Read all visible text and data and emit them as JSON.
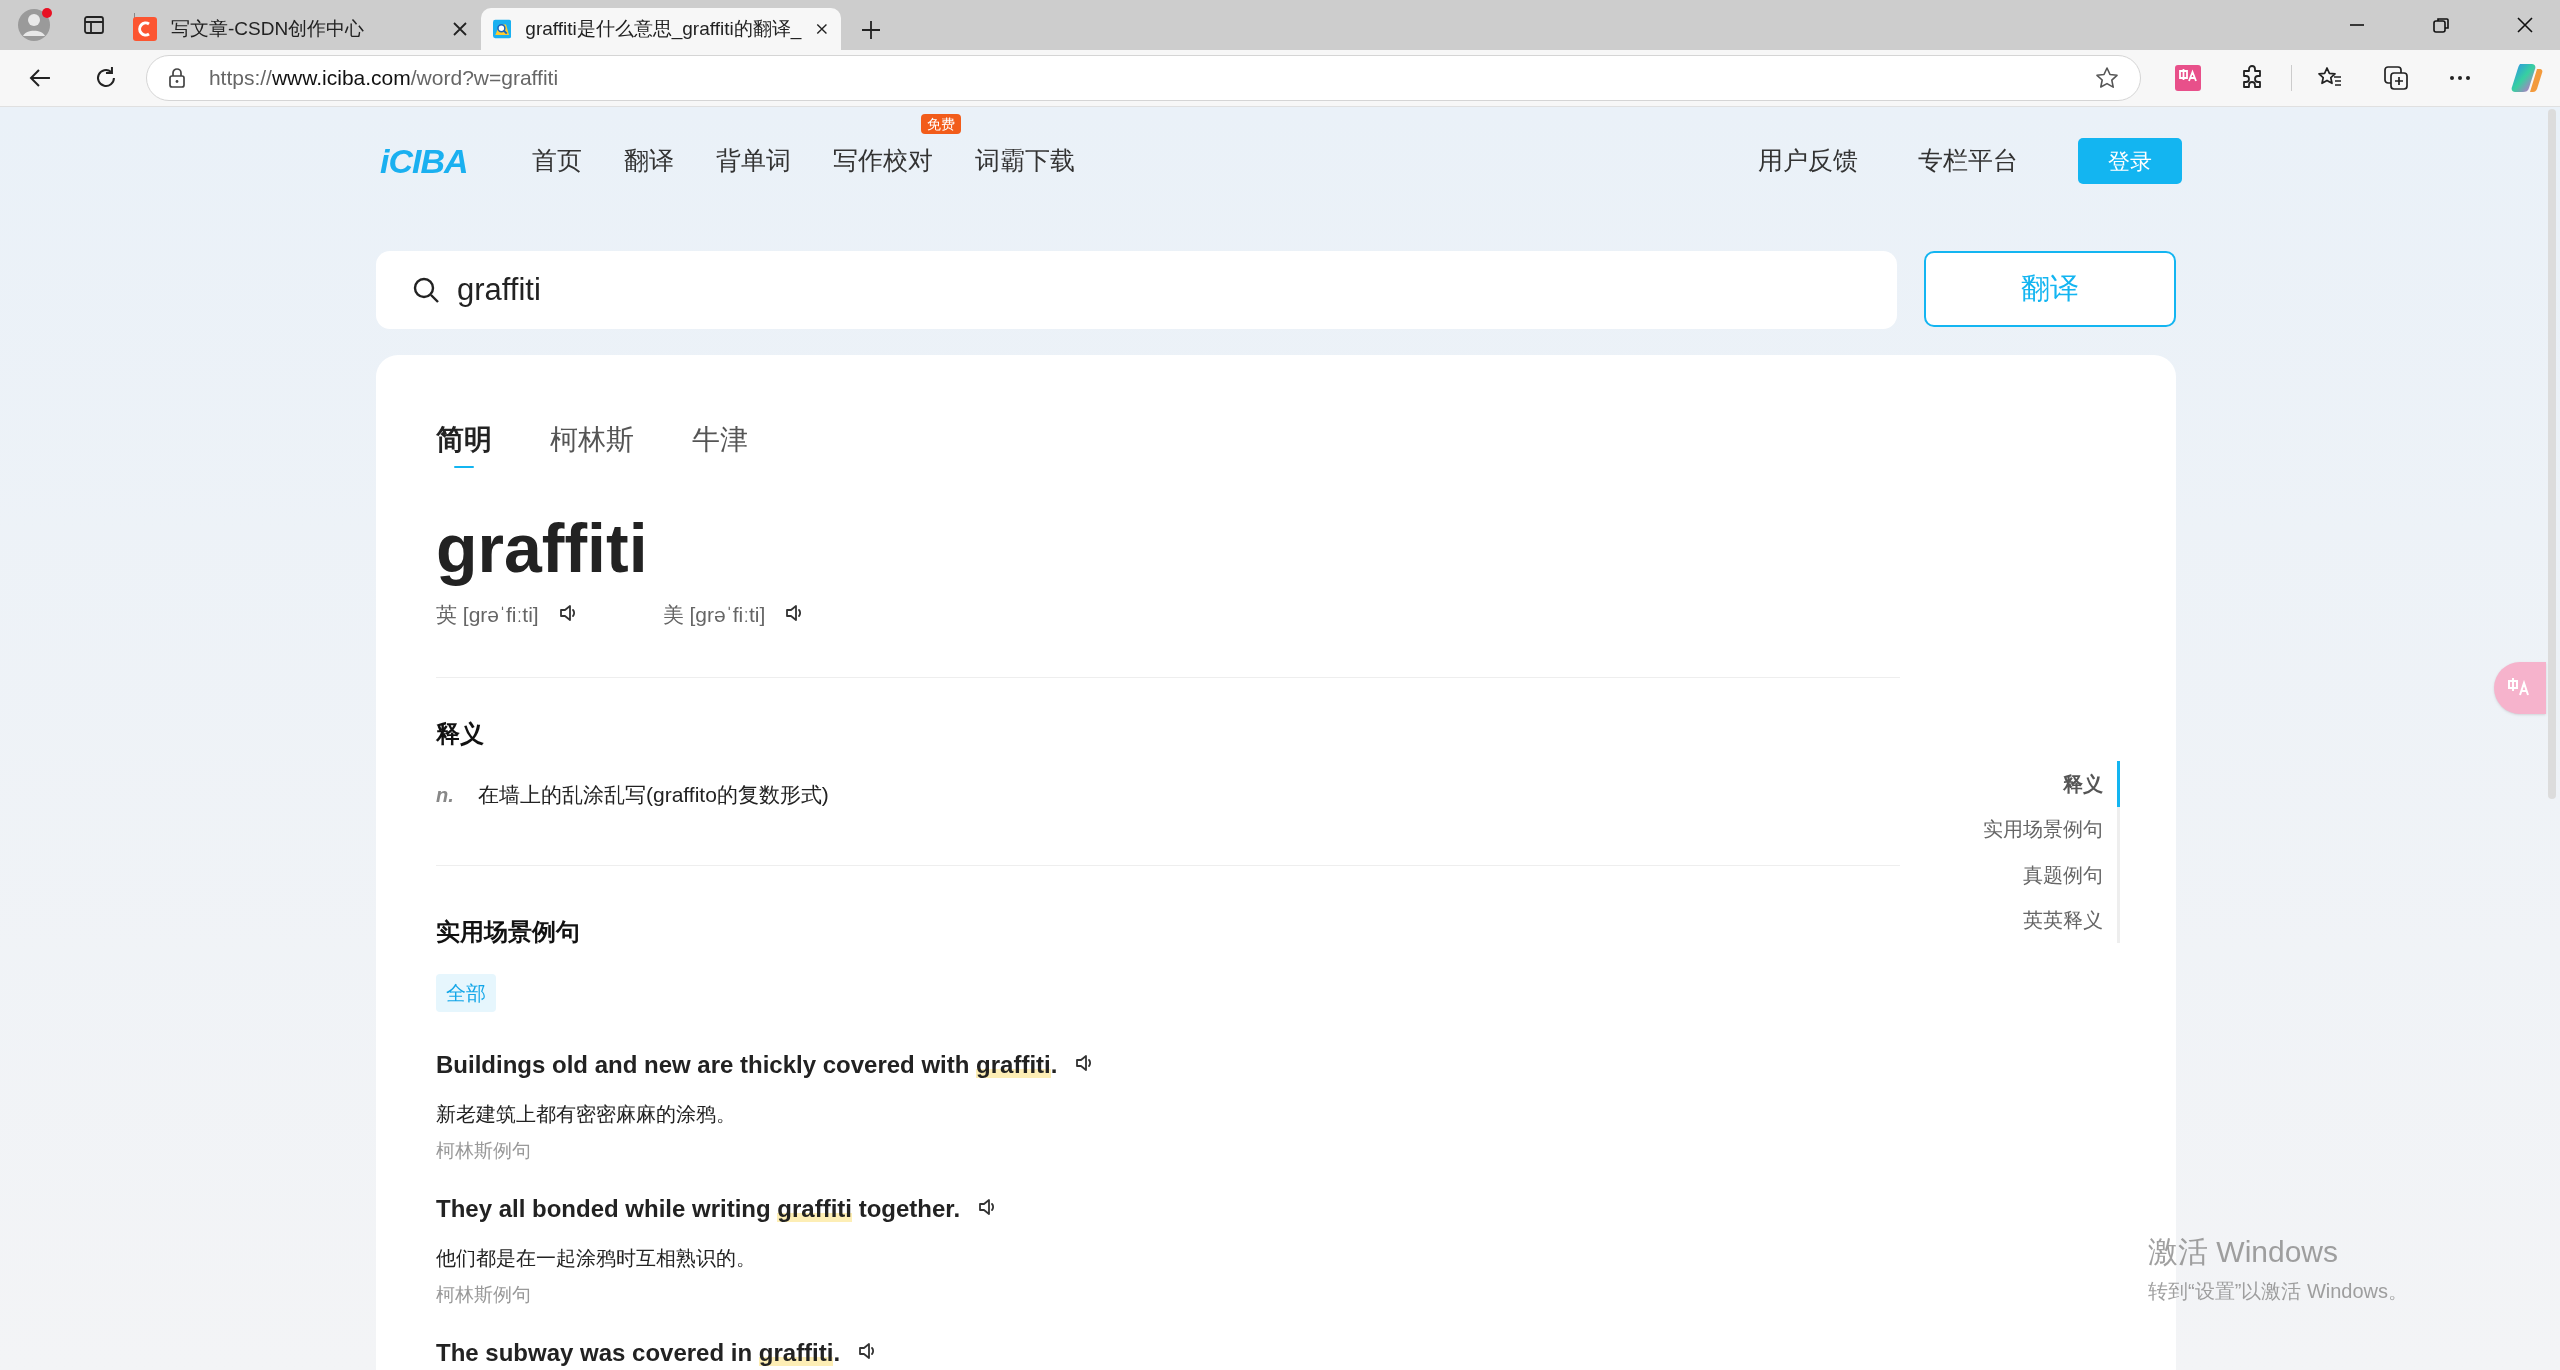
{
  "browser": {
    "tabs": [
      {
        "title": "写文章-CSDN创作中心",
        "kind": "csdn",
        "selected": false
      },
      {
        "title": "graffiti是什么意思_graffiti的翻译_",
        "kind": "iciba",
        "selected": true
      }
    ],
    "address": {
      "scheme": "https://",
      "host": "www.iciba.com",
      "path": "/word?w=graffiti"
    }
  },
  "site": {
    "logo": "iCIBA",
    "nav": [
      {
        "label": "首页"
      },
      {
        "label": "翻译"
      },
      {
        "label": "背单词"
      },
      {
        "label": "写作校对",
        "badge": "免费"
      },
      {
        "label": "词霸下载"
      }
    ],
    "nav_right": [
      "用户反馈",
      "专栏平台"
    ],
    "login": "登录"
  },
  "search": {
    "value": "graffiti",
    "button": "翻译"
  },
  "dict_tabs": [
    {
      "label": "简明",
      "selected": true
    },
    {
      "label": "柯林斯",
      "selected": false
    },
    {
      "label": "牛津",
      "selected": false
    }
  ],
  "word": "graffiti",
  "pronunciations": [
    {
      "label": "英",
      "ipa": "[grəˈfiːti]"
    },
    {
      "label": "美",
      "ipa": "[grəˈfiːti]"
    }
  ],
  "definitions": {
    "title": "释义",
    "items": [
      {
        "pos": "n.",
        "meaning": "在墙上的乱涂乱写(graffito的复数形式)"
      }
    ]
  },
  "examples": {
    "title": "实用场景例句",
    "filters": [
      {
        "label": "全部",
        "selected": true
      }
    ],
    "items": [
      {
        "segments": [
          {
            "text": "Buildings old and new are thickly covered with ",
            "highlighted": false
          },
          {
            "text": "graffiti",
            "highlighted": true
          },
          {
            "text": ".",
            "highlighted": false
          }
        ],
        "translation": "新老建筑上都有密密麻麻的涂鸦。",
        "source": "柯林斯例句"
      },
      {
        "segments": [
          {
            "text": "They all bonded while writing ",
            "highlighted": false
          },
          {
            "text": "graffiti",
            "highlighted": true
          },
          {
            "text": " together.",
            "highlighted": false
          }
        ],
        "translation": "他们都是在一起涂鸦时互相熟识的。",
        "source": "柯林斯例句"
      },
      {
        "segments": [
          {
            "text": "The subway was covered in ",
            "highlighted": false
          },
          {
            "text": "graffiti",
            "highlighted": true
          },
          {
            "text": ".",
            "highlighted": false
          }
        ]
      }
    ]
  },
  "outline": [
    {
      "label": "释义",
      "selected": true
    },
    {
      "label": "实用场景例句",
      "selected": false
    },
    {
      "label": "真题例句",
      "selected": false
    },
    {
      "label": "英英释义",
      "selected": false
    }
  ],
  "windows_activation": {
    "title": "激活 Windows",
    "message": "转到“设置”以激活 Windows。"
  }
}
